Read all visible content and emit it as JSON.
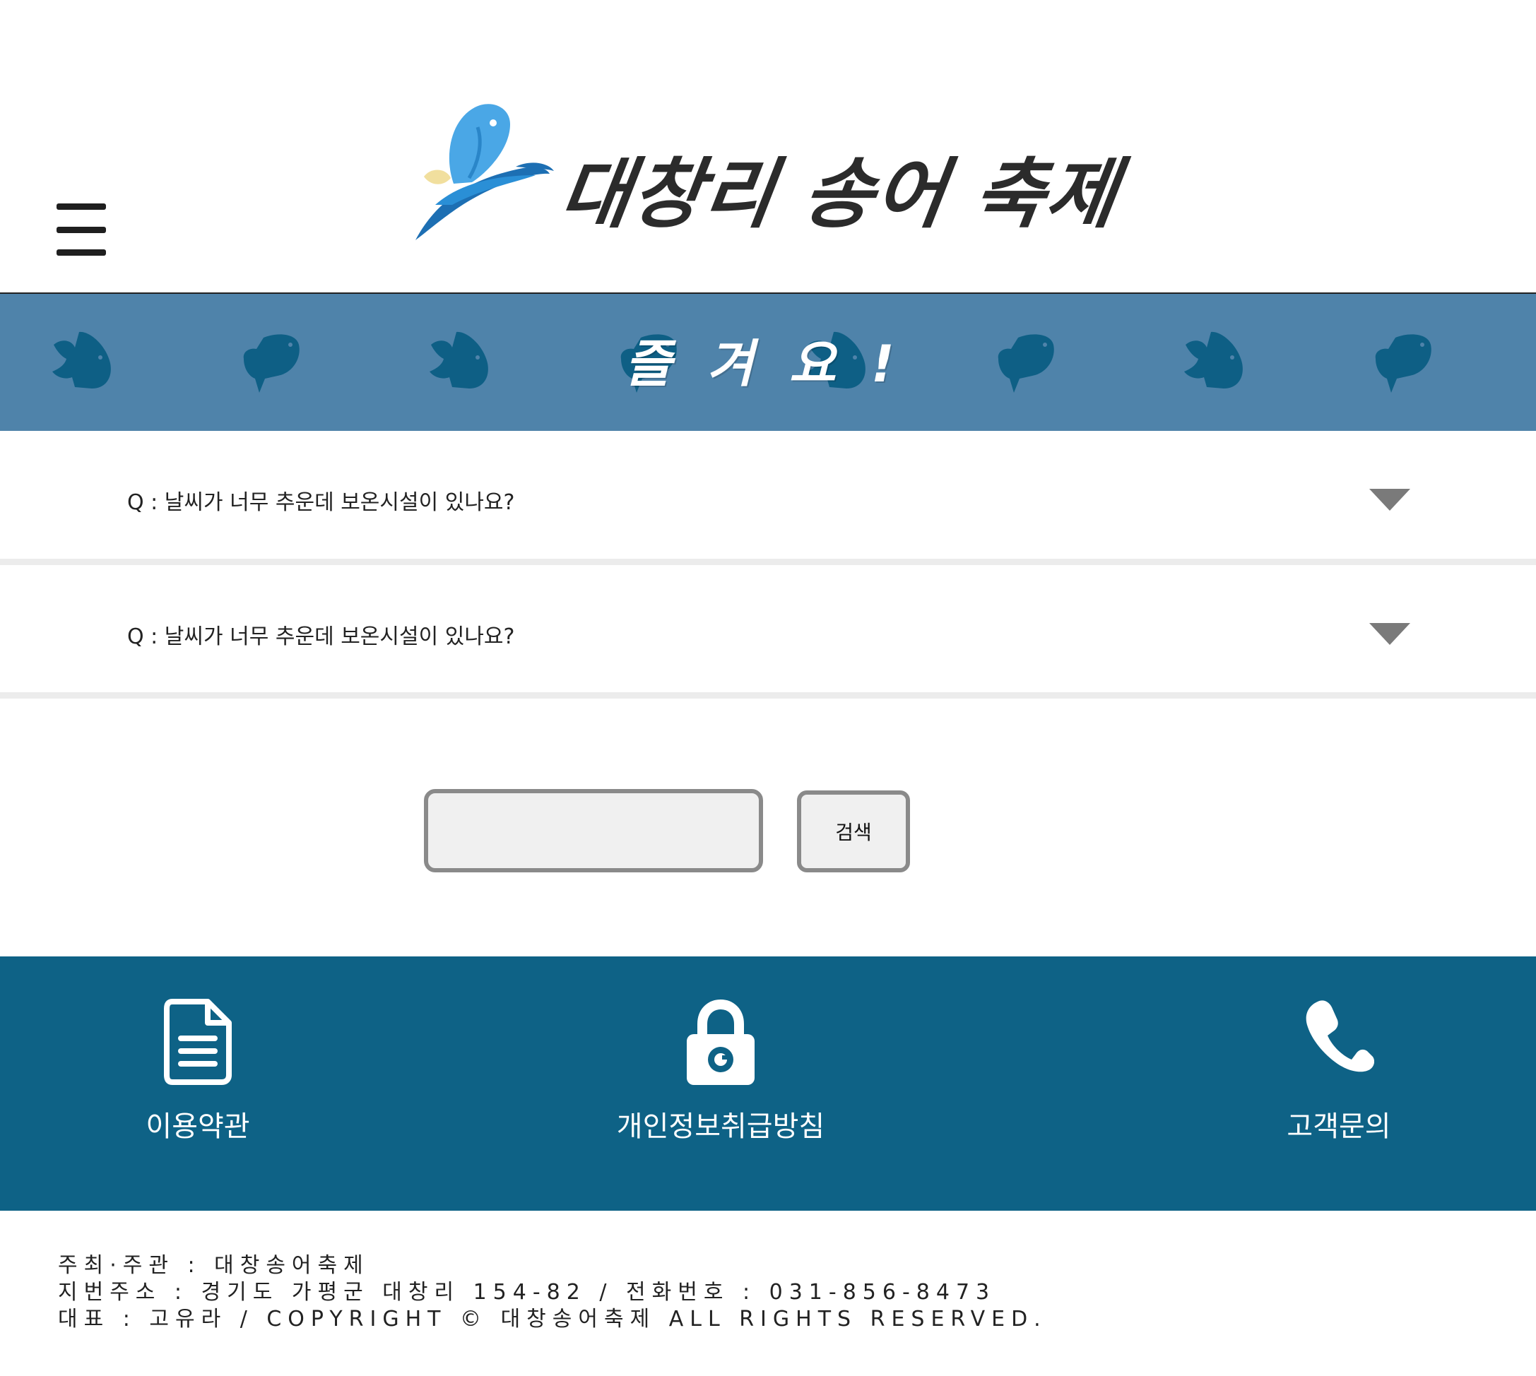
{
  "header": {
    "logo_text": "대창리 송어 축제",
    "menu_icon": "hamburger-menu-icon"
  },
  "banner": {
    "title": "즐겨요!",
    "background_color": "#4f83aa",
    "fish_color": "#0e5f85"
  },
  "faq": {
    "items": [
      {
        "question": "Q : 날씨가 너무 추운데 보온시설이 있나요?",
        "icon": "chevron-down-icon"
      },
      {
        "question": "Q : 날씨가 너무 추운데 보온시설이 있나요?",
        "icon": "chevron-down-icon"
      }
    ]
  },
  "search": {
    "input_value": "",
    "button_label": "검색"
  },
  "footer_links": {
    "background_color": "#0e6286",
    "items": [
      {
        "label": "이용약관",
        "icon": "document-icon"
      },
      {
        "label": "개인정보취급방침",
        "icon": "lock-icon"
      },
      {
        "label": "고객문의",
        "icon": "phone-icon"
      }
    ]
  },
  "footer_info": {
    "line1": "주최·주관 : 대창송어축제",
    "line2": "지번주소 : 경기도 가평군 대창리 154-82 / 전화번호 : 031-856-8473",
    "line3": "대표 : 고유라 / COPYRIGHT © 대창송어축제 ALL RIGHTS RESERVED."
  }
}
